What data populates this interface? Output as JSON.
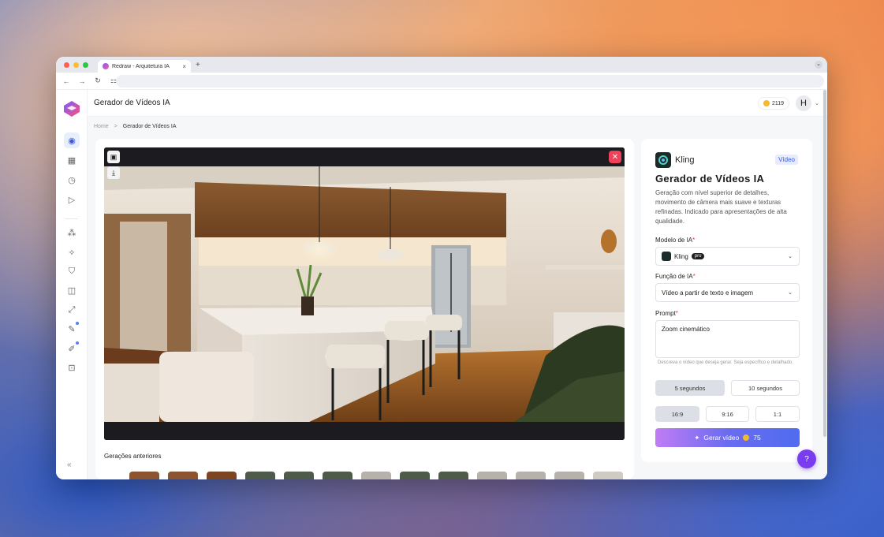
{
  "browser": {
    "tab_title": "Redraw - Arquitetura IA",
    "tab_close": "×",
    "new_tab": "+"
  },
  "header": {
    "title": "Gerador de Vídeos IA",
    "credits": "2119",
    "avatar_initial": "H"
  },
  "breadcrumb": {
    "home": "Home",
    "separator": ">",
    "current": "Gerador de Vídeos IA"
  },
  "main": {
    "previous_title": "Gerações anteriores"
  },
  "panel": {
    "brand": "Kling",
    "badge": "Vídeo",
    "title": "Gerador de Vídeos IA",
    "description": "Geração com nível superior de detalhes, movimento de câmera mais suave e texturas refinadas. Indicado para apresentações de alta qualidade.",
    "model_label": "Modelo de IA",
    "model_value": "Kling",
    "model_tag": "pro",
    "function_label": "Função de IA",
    "function_value": "Vídeo a partir de texto e imagem",
    "prompt_label": "Prompt",
    "required_mark": "*",
    "prompt_value": "Zoom cinemático",
    "prompt_hint": "Descreva o vídeo que deseja gerar. Seja específico e detalhado.",
    "durations": [
      "5 segundos",
      "10 segundos"
    ],
    "ratios": [
      "16:9",
      "9:16",
      "1:1"
    ],
    "generate_label": "Gerar vídeo",
    "generate_cost": "75"
  },
  "colors": {
    "accent": "#5b6cf0",
    "close": "#f0405a",
    "coin": "#f5b82e",
    "fab": "#7a3cf0"
  }
}
